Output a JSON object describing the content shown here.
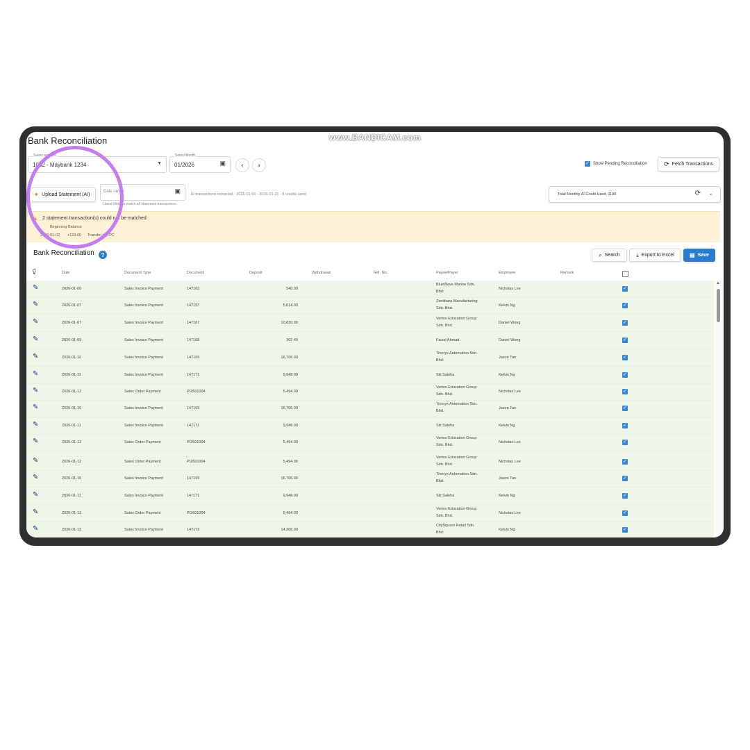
{
  "watermark": "www.BANDICAM.com",
  "page_title": "Bank Reconciliation",
  "account": {
    "label": "Select account",
    "value": "1002 - Maybank 1234"
  },
  "month": {
    "label": "Select Month",
    "value": "01/2026"
  },
  "show_pending": {
    "label": "Show Pending Reconciliation",
    "checked": true
  },
  "fetch_button": "Fetch Transactions",
  "upload_button": "Upload Statement (AI)",
  "date_range": {
    "placeholder": "Date range",
    "hint": "Leave blank to match all statement transactions"
  },
  "extract_info": "16 transactions extracted · 2026-01-01 - 2026-01-31 · 6 credits used",
  "credit_info": "Total Monthly AI Credit Used: 1190",
  "warning": {
    "title": "2 statement transaction(s) could not be matched",
    "sub1": "Beginning Balance",
    "sub2_date": "2026-01-02",
    "sub2_amount": "+123.00",
    "sub2_desc": "Transfer to FPC"
  },
  "section_title": "Bank Reconciliation",
  "search_button": "Search",
  "export_button": "Export to Excel",
  "save_button": "Save",
  "columns": {
    "date": "Date",
    "doc_type": "Document Type",
    "document": "Document",
    "deposit": "Deposit",
    "withdrawal": "Withdrawal",
    "ref_no": "Ref. No.",
    "payee": "Payee/Payer",
    "employee": "Employee",
    "remark": "Remark"
  },
  "rows": [
    {
      "date": "2026-01-06",
      "doc_type": "Sales Invoice Payment",
      "document": "147163",
      "deposit": "540.00",
      "payee_1": "BlueWave Marine Sdn.",
      "payee_2": "Bhd.",
      "employee": "Nicholas Lee"
    },
    {
      "date": "2026-01-07",
      "doc_type": "Sales Invoice Payment",
      "document": "147157",
      "deposit": "5,614.00",
      "payee_1": "Zenithara Manufacturing",
      "payee_2": "Sdn. Bhd.",
      "employee": "Kelvin Ng"
    },
    {
      "date": "2026-01-07",
      "doc_type": "Sales Invoice Payment",
      "document": "147167",
      "deposit": "10,830.00",
      "payee_1": "Vertex Education Group",
      "payee_2": "Sdn. Bhd.",
      "employee": "Daniel Wong"
    },
    {
      "date": "2026-01-09",
      "doc_type": "Sales Invoice Payment",
      "document": "147168",
      "deposit": "302.40",
      "payee_1": "Faizal Ahmad",
      "payee_2": "",
      "employee": "Daniel Wong"
    },
    {
      "date": "2026-01-10",
      "doc_type": "Sales Invoice Payment",
      "document": "147169",
      "deposit": "16,706.00",
      "payee_1": "Trionyx Automation Sdn.",
      "payee_2": "Bhd.",
      "employee": "Jason Tan"
    },
    {
      "date": "2026-01-11",
      "doc_type": "Sales Invoice Payment",
      "document": "147171",
      "deposit": "9,948.00",
      "payee_1": "Siti Saleha",
      "payee_2": "",
      "employee": "Kelvin Ng"
    },
    {
      "date": "2026-01-12",
      "doc_type": "Sales Order Payment",
      "document": "PI2601004",
      "deposit": "5,494.00",
      "payee_1": "Vertex Education Group",
      "payee_2": "Sdn. Bhd.",
      "employee": "Nicholas Lee"
    },
    {
      "date": "2026-01-10",
      "doc_type": "Sales Invoice Payment",
      "document": "147169",
      "deposit": "16,706.00",
      "payee_1": "Trionyx Automation Sdn.",
      "payee_2": "Bhd.",
      "employee": "Jason Tan"
    },
    {
      "date": "2026-01-11",
      "doc_type": "Sales Invoice Payment",
      "document": "147171",
      "deposit": "9,948.00",
      "payee_1": "Siti Saleha",
      "payee_2": "",
      "employee": "Kelvin Ng"
    },
    {
      "date": "2026-01-12",
      "doc_type": "Sales Order Payment",
      "document": "PI2601004",
      "deposit": "5,494.00",
      "payee_1": "Vertex Education Group",
      "payee_2": "Sdn. Bhd.",
      "employee": "Nicholas Lee"
    },
    {
      "date": "2026-01-12",
      "doc_type": "Sales Order Payment",
      "document": "PI2601004",
      "deposit": "5,494.00",
      "payee_1": "Vertex Education Group",
      "payee_2": "Sdn. Bhd.",
      "employee": "Nicholas Lee"
    },
    {
      "date": "2026-01-10",
      "doc_type": "Sales Invoice Payment",
      "document": "147169",
      "deposit": "16,706.00",
      "payee_1": "Trionyx Automation Sdn.",
      "payee_2": "Bhd.",
      "employee": "Jason Tan"
    },
    {
      "date": "2026-01-11",
      "doc_type": "Sales Invoice Payment",
      "document": "147171",
      "deposit": "9,948.00",
      "payee_1": "Siti Saleha",
      "payee_2": "",
      "employee": "Kelvin Ng"
    },
    {
      "date": "2026-01-12",
      "doc_type": "Sales Order Payment",
      "document": "PI2601004",
      "deposit": "5,494.00",
      "payee_1": "Vertex Education Group",
      "payee_2": "Sdn. Bhd.",
      "employee": "Nicholas Lee"
    },
    {
      "date": "2026-01-13",
      "doc_type": "Sales Invoice Payment",
      "document": "147172",
      "deposit": "14,306.00",
      "payee_1": "CitySquare Retail Sdn.",
      "payee_2": "Bhd.",
      "employee": "Kelvin Ng"
    }
  ],
  "colors": {
    "accent": "#2a7bd1",
    "row_bg": "#eef6e8",
    "warning_bg": "#fdf1d6",
    "highlight_circle": "#c57cf0"
  },
  "icons": [
    "sparkle-icon",
    "calendar-icon",
    "chevron-left-icon",
    "chevron-right-icon",
    "refresh-icon",
    "warning-icon",
    "help-icon",
    "search-icon",
    "download-icon",
    "save-icon",
    "filter-off-icon",
    "edit-icon",
    "checkbox-icon"
  ]
}
